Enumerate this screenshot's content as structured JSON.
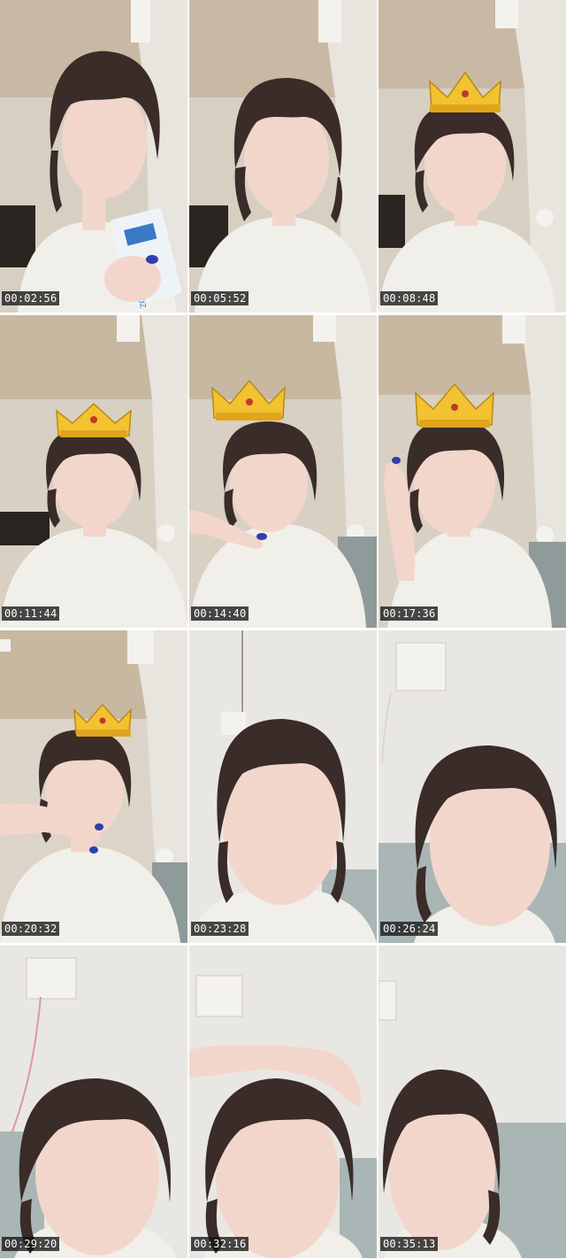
{
  "sheet": {
    "columns": 3,
    "rows": 4
  },
  "frames": [
    {
      "timestamp": "00:02:56",
      "scene": "ceiling-room",
      "overlay": "none",
      "prop": "milk-carton",
      "carton_text": "HMOWTOZ"
    },
    {
      "timestamp": "00:05:52",
      "scene": "ceiling-room",
      "overlay": "none",
      "prop": "none"
    },
    {
      "timestamp": "00:08:48",
      "scene": "ceiling-room",
      "overlay": "crown",
      "prop": "none"
    },
    {
      "timestamp": "00:11:44",
      "scene": "ceiling-room",
      "overlay": "crown",
      "prop": "none"
    },
    {
      "timestamp": "00:14:40",
      "scene": "ceiling-room",
      "overlay": "crown",
      "prop": "hand-on-chin"
    },
    {
      "timestamp": "00:17:36",
      "scene": "ceiling-room",
      "overlay": "crown",
      "prop": "hand-on-cheek"
    },
    {
      "timestamp": "00:20:32",
      "scene": "ceiling-room",
      "overlay": "crown",
      "prop": "hand-on-chin"
    },
    {
      "timestamp": "00:23:28",
      "scene": "white-wall",
      "overlay": "none",
      "prop": "none"
    },
    {
      "timestamp": "00:26:24",
      "scene": "white-wall",
      "overlay": "none",
      "prop": "outlet"
    },
    {
      "timestamp": "00:29:20",
      "scene": "white-wall",
      "overlay": "none",
      "prop": "outlet"
    },
    {
      "timestamp": "00:32:16",
      "scene": "white-wall",
      "overlay": "none",
      "prop": "arm-on-head"
    },
    {
      "timestamp": "00:35:13",
      "scene": "white-wall",
      "overlay": "none",
      "prop": "none"
    }
  ],
  "colors": {
    "timestamp_bg": "#141414",
    "timestamp_text": "#ffffff",
    "crown_gold": "#f2c230",
    "hair": "#3a2c28",
    "skin": "#f3d6cb",
    "shirt": "#f1efea"
  }
}
